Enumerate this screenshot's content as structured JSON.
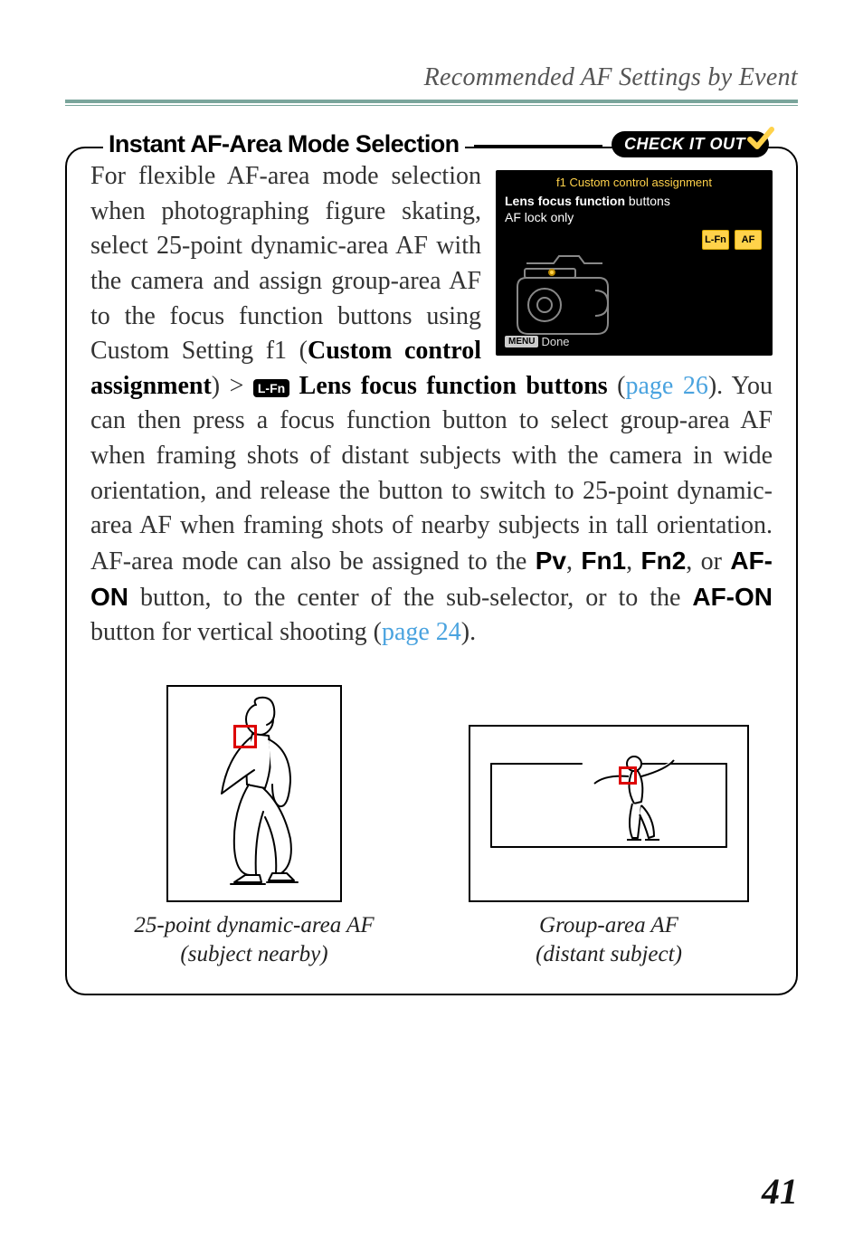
{
  "breadcrumb": "Recommended AF Settings by Event",
  "callout": {
    "title": "Instant AF-Area Mode Selection",
    "badge": "CHECK IT OUT",
    "para1_a": "For flexible AF-area mode selection when photographing figure skating, select 25-point dynamic-area AF with the camera and assign group-area AF to the focus function buttons using Custom Setting f1 (",
    "para1_b_bold": "Custom control assignment",
    "para1_c": ") > ",
    "lfn_label": "L-Fn",
    "para1_d_bold": " Lens focus function buttons",
    "para1_e": " (",
    "link1": "page 26",
    "para1_f": "). You can then press a focus function button to select group-area AF when framing shots of distant subjects with the camera in wide orientation, and release the button to switch to 25-point dynamic-area AF when framing shots of nearby subjects in tall orientation. AF-area mode can also be assigned to the ",
    "btn_pv": "Pv",
    "sep_comma1": ", ",
    "btn_fn1": "Fn1",
    "sep_comma2": ", ",
    "btn_fn2": "Fn2",
    "sep_or": ", or ",
    "btn_afon": "AF-ON",
    "para1_g": " button, to the center of the sub-selector, or to the ",
    "btn_afon2": "AF-ON",
    "para1_h": " button for vertical shooting (",
    "link2": "page 24",
    "para1_i": ")."
  },
  "menu": {
    "header_prefix": "f1",
    "header": "Custom control assignment",
    "line1_a": "Lens focus function",
    "line1_b": " buttons",
    "line2": "AF lock only",
    "badge1": "L-Fn",
    "badge2": "AF",
    "done_pill": "MENU",
    "done": "Done"
  },
  "figures": {
    "left_caption_l1": "25-point dynamic-area AF",
    "left_caption_l2": "(subject nearby)",
    "right_caption_l1": "Group-area AF",
    "right_caption_l2": "(distant subject)"
  },
  "page_number": "41"
}
